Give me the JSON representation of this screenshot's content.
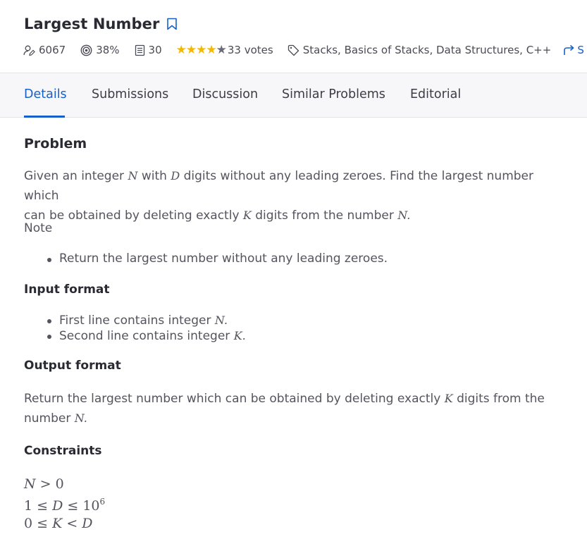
{
  "header": {
    "title": "Largest Number",
    "solved_count": "6067",
    "accuracy": "38%",
    "submissions_count": "30",
    "rating_stars": 4,
    "rating_max": 5,
    "votes": "33 votes",
    "tags": "Stacks, Basics of Stacks, Data Structures, C++",
    "share_label": "S"
  },
  "tabs": [
    {
      "label": "Details",
      "active": true
    },
    {
      "label": "Submissions",
      "active": false
    },
    {
      "label": "Discussion",
      "active": false
    },
    {
      "label": "Similar Problems",
      "active": false
    },
    {
      "label": "Editorial",
      "active": false
    }
  ],
  "problem": {
    "heading": "Problem",
    "p1_a": "Given an integer ",
    "p1_n": "N",
    "p1_b": " with ",
    "p1_d": "D",
    "p1_c": " digits without any leading zeroes. Find the largest number which",
    "p1_line2_a": "can be obtained by deleting exactly ",
    "p1_k": "K",
    "p1_line2_b": " digits from the number ",
    "p1_n2": "N.",
    "note_label": "Note",
    "note_items": [
      "Return the largest number without any leading zeroes."
    ],
    "input_heading": "Input format",
    "input_item1_a": "First line contains integer ",
    "input_item1_var": "N.",
    "input_item2_a": "Second line contains integer ",
    "input_item2_var": "K.",
    "output_heading": "Output format",
    "output_line1_a": "Return the largest number which can be obtained by deleting exactly ",
    "output_k": "K",
    "output_line1_b": " digits from the",
    "output_line2_a": "number ",
    "output_n": "N.",
    "constraints_heading": "Constraints",
    "c1_var": "N",
    "c1_rest": " > 0",
    "c2_a": "1 ≤ ",
    "c2_var": "D",
    "c2_b": " ≤ 10",
    "c2_exp": "6",
    "c3_a": "0 ≤ ",
    "c3_var1": "K",
    "c3_b": " < ",
    "c3_var2": "D"
  },
  "colors": {
    "accent": "#1660c9",
    "star": "#f5b800",
    "text": "#54545e"
  }
}
